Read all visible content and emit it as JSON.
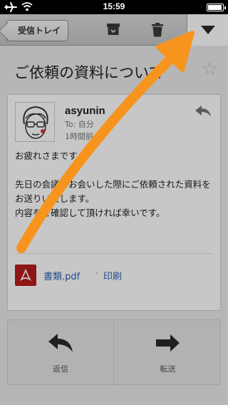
{
  "status_bar": {
    "time": "15:59"
  },
  "toolbar": {
    "back_label": "受信トレイ",
    "icons": [
      "archive-icon",
      "trash-icon",
      "chevron-down-icon"
    ]
  },
  "subject": "ご依頼の資料について",
  "message": {
    "sender": "asyunin",
    "recipient": "To: 自分",
    "timestamp": "1時間前",
    "body": [
      "お疲れさまです。",
      "",
      "先日の会議でお会いした際にご依頼された資料をお送りいたします。",
      "内容をご確認して頂ければ幸いです。"
    ],
    "attachment": {
      "name": "書類.pdf",
      "separator": "·",
      "print_label": "印刷"
    }
  },
  "actions": {
    "reply_label": "返信",
    "forward_label": "転送"
  },
  "colors": {
    "overlay_arrow": "#f7941d",
    "link": "#2b5fb4",
    "pdf": "#b71c1c"
  }
}
